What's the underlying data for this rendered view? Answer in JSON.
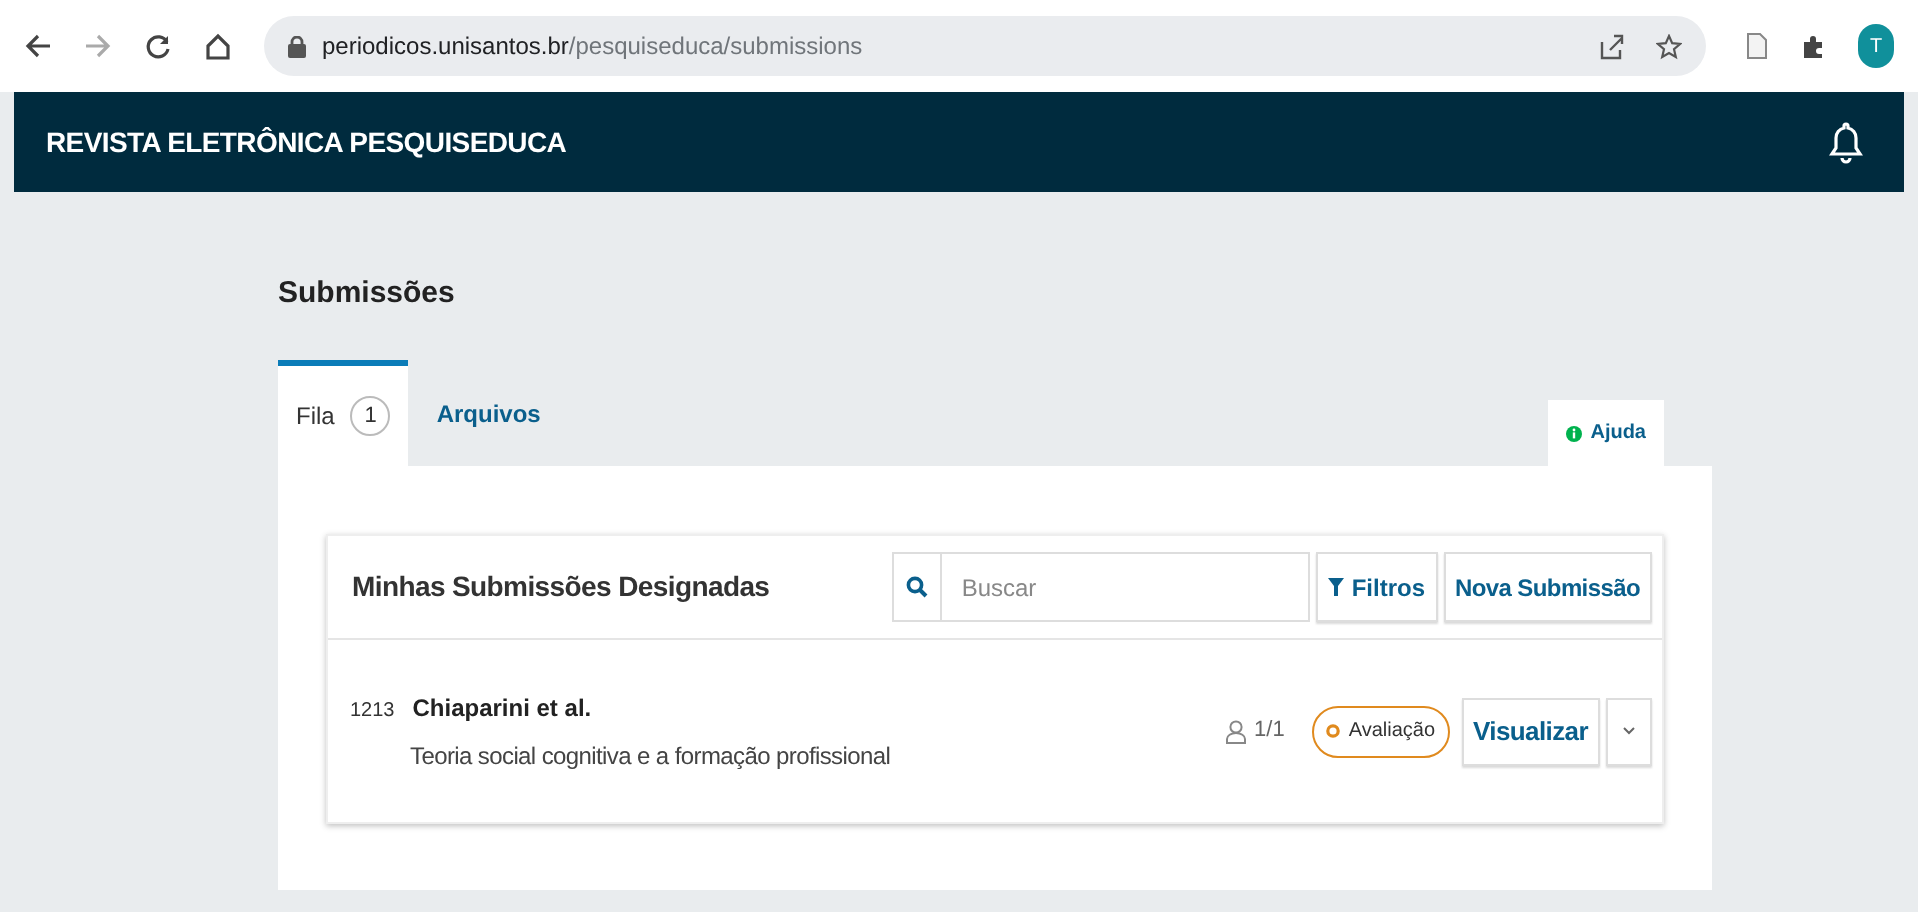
{
  "browser": {
    "url_host": "periodicos.unisantos.br",
    "url_path": "/pesquiseduca/submissions",
    "profile_initial": "T"
  },
  "header": {
    "title": "REVISTA ELETRÔNICA PESQUISEDUCA"
  },
  "page_title": "Submissões",
  "tabs": [
    {
      "label": "Fila",
      "count": "1",
      "selected": true
    },
    {
      "label": "Arquivos",
      "selected": false
    }
  ],
  "help": "Ajuda",
  "list": {
    "title": "Minhas Submissões Designadas",
    "search": {
      "placeholder": "Buscar"
    },
    "filter_button": "Filtros",
    "new_button": "Nova Submissão",
    "rows": [
      {
        "id": "1213",
        "authors": "Chiaparini et al.",
        "title": "Teoria social cognitiva e a formação profissional",
        "reviews": "1/1",
        "stage": "Avaliação",
        "view_button": "Visualizar"
      }
    ]
  }
}
